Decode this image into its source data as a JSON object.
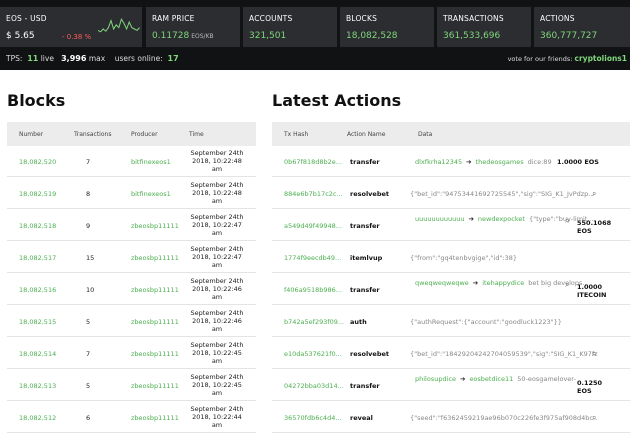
{
  "ticker": {
    "eos_usd": {
      "label": "EOS - USD",
      "price": "$ 5.65",
      "change": "- 0.38 %"
    },
    "stats": [
      {
        "label": "RAM PRICE",
        "value": "0.11728",
        "unit": "EOS/KB"
      },
      {
        "label": "ACCOUNTS",
        "value": "321,501",
        "unit": ""
      },
      {
        "label": "BLOCKS",
        "value": "18,082,528",
        "unit": ""
      },
      {
        "label": "TRANSACTIONS",
        "value": "361,533,696",
        "unit": ""
      },
      {
        "label": "ACTIONS",
        "value": "360,777,727",
        "unit": ""
      }
    ],
    "tps_label": "TPS:",
    "tps_live": "11",
    "live_label": "live",
    "tps_max": "3,996",
    "max_label": "max",
    "users_label": "users online:",
    "users_online": "17",
    "vote_label": "vote for our friends:",
    "vote_friend": "cryptolions1"
  },
  "blocks": {
    "title": "Blocks",
    "columns": [
      "Number",
      "Transactions",
      "Producer",
      "Time"
    ],
    "rows": [
      {
        "number": "18,082,520",
        "tx": "7",
        "producer": "bitfinexeos1",
        "t1": "September 24th",
        "t2": "2018, 10:22:48",
        "t3": "am"
      },
      {
        "number": "18,082,519",
        "tx": "8",
        "producer": "bitfinexeos1",
        "t1": "September 24th",
        "t2": "2018, 10:22:48",
        "t3": "am"
      },
      {
        "number": "18,082,518",
        "tx": "9",
        "producer": "zbeosbp11111",
        "t1": "September 24th",
        "t2": "2018, 10:22:47",
        "t3": "am"
      },
      {
        "number": "18,082,517",
        "tx": "15",
        "producer": "zbeosbp11111",
        "t1": "September 24th",
        "t2": "2018, 10:22:47",
        "t3": "am"
      },
      {
        "number": "18,082,516",
        "tx": "10",
        "producer": "zbeosbp11111",
        "t1": "September 24th",
        "t2": "2018, 10:22:46",
        "t3": "am"
      },
      {
        "number": "18,082,515",
        "tx": "5",
        "producer": "zbeosbp11111",
        "t1": "September 24th",
        "t2": "2018, 10:22:46",
        "t3": "am"
      },
      {
        "number": "18,082,514",
        "tx": "7",
        "producer": "zbeosbp11111",
        "t1": "September 24th",
        "t2": "2018, 10:22:45",
        "t3": "am"
      },
      {
        "number": "18,082,513",
        "tx": "5",
        "producer": "zbeosbp11111",
        "t1": "September 24th",
        "t2": "2018, 10:22:45",
        "t3": "am"
      },
      {
        "number": "18,082,512",
        "tx": "6",
        "producer": "zbeosbp11111",
        "t1": "September 24th",
        "t2": "2018, 10:22:44",
        "t3": "am"
      }
    ]
  },
  "actions": {
    "title": "Latest Actions",
    "columns": [
      "Tx Hash",
      "Action Name",
      "Data"
    ],
    "rows": [
      {
        "hash": "0b67f818d8b2e...",
        "name": "transfer",
        "from": "dlxfkrha12345",
        "to": "thedeosgames",
        "memo": "dice:89",
        "amount": "1.0000 EOS",
        "amount2": ""
      },
      {
        "hash": "884e6b7b17c2c...",
        "name": "resolvebet",
        "json": "{\"bet_id\":\"94753441692725545\",\"sig\":\"SIG_K1_JvPdzp...",
        "q": true
      },
      {
        "hash": "a549d49f49948...",
        "name": "transfer",
        "from": "uuuuuuuuuuuu",
        "to": "newdexpocket",
        "memo": "{\"type\":\"buy-limit...",
        "amount": "550.1068",
        "amount2": "EOS",
        "q": true
      },
      {
        "hash": "1774f9eecdb49...",
        "name": "itemlvup",
        "json": "{\"from\":\"gq4tenbvgige\",\"id\":38}"
      },
      {
        "hash": "f406a9518b986...",
        "name": "transfer",
        "from": "qweqweqweqwe",
        "to": "itehappydice",
        "memo": "bet big develops...",
        "amount": "1.0000",
        "amount2": "ITECOIN",
        "q": true
      },
      {
        "hash": "b742a5ef293f09...",
        "name": "auth",
        "json": "{\"authRequest\":{\"account\":\"goodluck1223\"}}"
      },
      {
        "hash": "e10da537621f0...",
        "name": "resolvebet",
        "json": "{\"bet_id\":\"18429204242704059539\",\"sig\":\"SIG_K1_K97fz...",
        "q": true
      },
      {
        "hash": "04272bba03d14...",
        "name": "transfer",
        "from": "philosupdice",
        "to": "eosbetdice11",
        "memo": "50-eosgamelover-",
        "amount": "0.1250",
        "amount2": "EOS"
      },
      {
        "hash": "36570fdb6c4d4...",
        "name": "reveal",
        "json": "{\"seed\":\"f6362459219ae96b070c226fe3f975af908d4bc...",
        "q": true
      }
    ]
  },
  "colors": {
    "accent": "#4caf50",
    "topbar": "#111214",
    "tile": "#2c2d31",
    "negative": "#ff5a5a"
  },
  "sparkline": [
    0.55,
    0.6,
    0.5,
    0.58,
    0.45,
    0.2,
    0.5,
    0.35,
    0.45,
    0.15,
    0.3,
    0.5,
    0.25,
    0.45,
    0.5,
    0.55,
    0.45
  ]
}
